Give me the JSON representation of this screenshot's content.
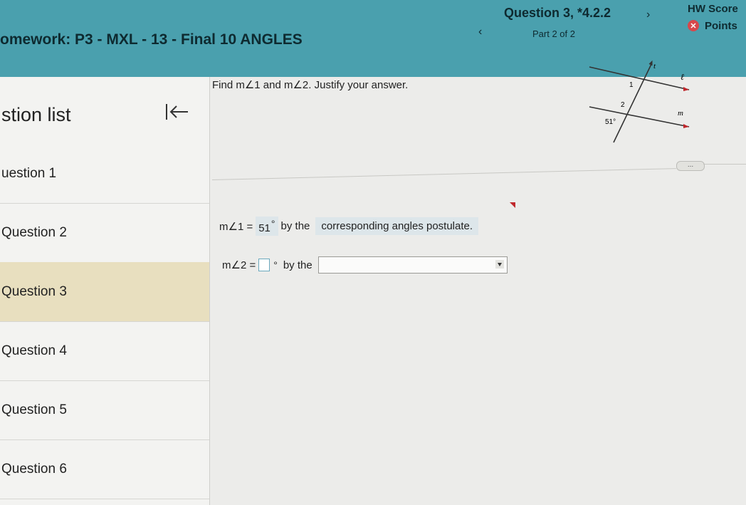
{
  "header": {
    "homework_title": "omework:  P3 - MXL - 13 - Final 10 ANGLES",
    "question_title": "Question 3, *4.2.2",
    "part": "Part 2 of 2",
    "hw_score_label": "HW Score",
    "points_label": "Points",
    "prev_symbol": "‹",
    "next_symbol": "›"
  },
  "sidebar": {
    "title": "stion list",
    "items": [
      {
        "label": "uestion 1"
      },
      {
        "label": "Question 2"
      },
      {
        "label": "Question 3"
      },
      {
        "label": "Question 4"
      },
      {
        "label": "Question 5"
      },
      {
        "label": "Question 6"
      }
    ]
  },
  "question": {
    "prompt": "Find m∠1 and m∠2. Justify your answer.",
    "diagram": {
      "labels": {
        "t": "t",
        "l": "ℓ",
        "m": "m",
        "one": "1",
        "two": "2",
        "angle": "51°"
      }
    },
    "more_label": "...",
    "answer1": {
      "prefix": "m∠1 =",
      "value": "51",
      "degree": "°",
      "by_the": "by the",
      "reason": "corresponding angles postulate."
    },
    "answer2": {
      "prefix": "m∠2 =",
      "degree": "°",
      "by_the": "by the",
      "dropdown_value": ""
    }
  },
  "colors": {
    "header": "#4aa0ae",
    "active_item": "#e8dfbf",
    "error": "#d8474b"
  }
}
